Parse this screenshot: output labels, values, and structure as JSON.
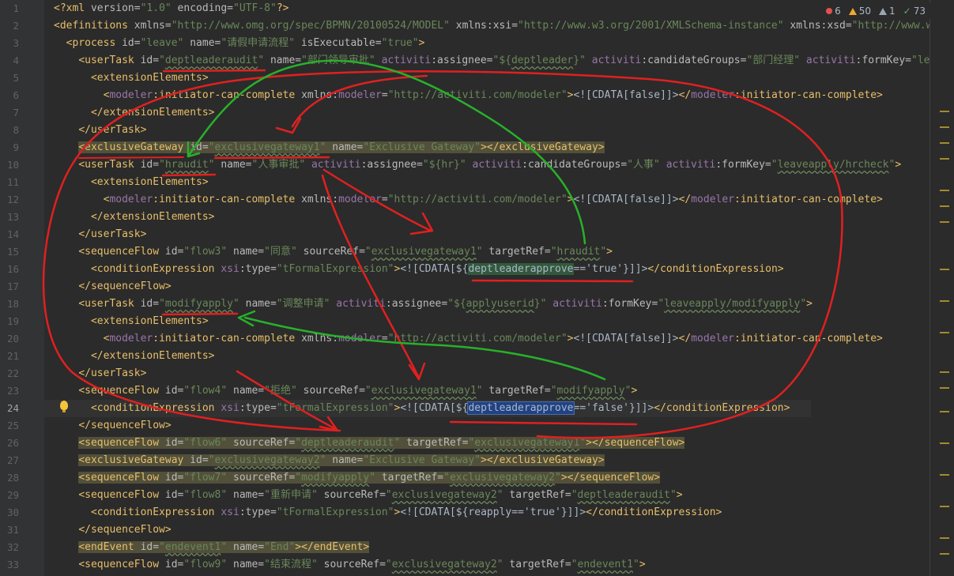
{
  "inspections": {
    "errors": "6",
    "warnings": "50",
    "weak": "1",
    "ok": "73"
  },
  "colors": {
    "annotation_red": "#e02020",
    "annotation_green": "#27b12a"
  },
  "current_line": "24",
  "lines": [
    {
      "n": "1",
      "tokens": [
        [
          "p",
          "<?"
        ],
        [
          "t",
          "xml "
        ],
        [
          "a",
          "version="
        ],
        [
          "v",
          "\"1.0\""
        ],
        [
          "a",
          " encoding="
        ],
        [
          "v",
          "\"UTF-8\""
        ],
        [
          "p",
          "?>"
        ]
      ]
    },
    {
      "n": "2",
      "tokens": [
        [
          "t",
          "<definitions "
        ],
        [
          "a",
          "xmlns="
        ],
        [
          "v",
          "\"http://www.omg.org/spec/BPMN/20100524/MODEL\""
        ],
        [
          "a",
          " xmlns:xsi="
        ],
        [
          "v",
          "\"http://www.w3.org/2001/XMLSchema-instance\""
        ],
        [
          "a",
          " xmlns:xsd="
        ],
        [
          "v",
          "\"http://www.w"
        ]
      ]
    },
    {
      "n": "3",
      "tokens": [
        [
          "x",
          "  "
        ],
        [
          "t",
          "<process "
        ],
        [
          "a",
          "id="
        ],
        [
          "v",
          "\"leave\""
        ],
        [
          "a",
          " name="
        ],
        [
          "v",
          "\"请假申请流程\""
        ],
        [
          "a",
          " isExecutable="
        ],
        [
          "v",
          "\"true\""
        ],
        [
          "t",
          ">"
        ]
      ]
    },
    {
      "n": "4",
      "tokens": [
        [
          "x",
          "    "
        ],
        [
          "t",
          "<userTask "
        ],
        [
          "a",
          "id="
        ],
        [
          "v",
          "\""
        ],
        [
          "vu",
          "deptleaderaudit"
        ],
        [
          "v",
          "\""
        ],
        [
          "a",
          " name="
        ],
        [
          "v",
          "\"部门领导审批\""
        ],
        [
          "a",
          " "
        ],
        [
          "n",
          "activiti"
        ],
        [
          "a",
          ":assignee="
        ],
        [
          "v",
          "\"${"
        ],
        [
          "vu",
          "deptleader"
        ],
        [
          "v",
          "}\""
        ],
        [
          "a",
          " "
        ],
        [
          "n",
          "activiti"
        ],
        [
          "a",
          ":candidateGroups="
        ],
        [
          "v",
          "\"部门经理\""
        ],
        [
          "a",
          " "
        ],
        [
          "n",
          "activiti"
        ],
        [
          "a",
          ":formKey="
        ],
        [
          "v",
          "\"lea"
        ]
      ]
    },
    {
      "n": "5",
      "tokens": [
        [
          "x",
          "      "
        ],
        [
          "t",
          "<extensionElements>"
        ]
      ]
    },
    {
      "n": "6",
      "tokens": [
        [
          "x",
          "        "
        ],
        [
          "t",
          "<"
        ],
        [
          "n",
          "modeler"
        ],
        [
          "t",
          ":initiator-can-complete "
        ],
        [
          "a",
          "xmlns:"
        ],
        [
          "n",
          "modeler"
        ],
        [
          "a",
          "="
        ],
        [
          "v",
          "\"http://activiti.com/modeler\""
        ],
        [
          "t",
          ">"
        ],
        [
          "x",
          "<![CDATA[false]]>"
        ],
        [
          "t",
          "</"
        ],
        [
          "n",
          "modeler"
        ],
        [
          "t",
          ":initiator-can-complete>"
        ]
      ]
    },
    {
      "n": "7",
      "tokens": [
        [
          "x",
          "      "
        ],
        [
          "t",
          "</extensionElements>"
        ]
      ]
    },
    {
      "n": "8",
      "tokens": [
        [
          "x",
          "    "
        ],
        [
          "t",
          "</userTask>"
        ]
      ]
    },
    {
      "n": "9",
      "hl": true,
      "tokens": [
        [
          "x",
          "    "
        ],
        [
          "t",
          "<exclusiveGateway "
        ],
        [
          "a",
          "id="
        ],
        [
          "v",
          "\""
        ],
        [
          "vu",
          "exclusivegateway1"
        ],
        [
          "v",
          "\""
        ],
        [
          "a",
          " name="
        ],
        [
          "v",
          "\"Exclusive Gateway\""
        ],
        [
          "t",
          "></exclusiveGateway>"
        ]
      ]
    },
    {
      "n": "10",
      "tokens": [
        [
          "x",
          "    "
        ],
        [
          "t",
          "<userTask "
        ],
        [
          "a",
          "id="
        ],
        [
          "v",
          "\""
        ],
        [
          "vu",
          "hraudit"
        ],
        [
          "v",
          "\""
        ],
        [
          "a",
          " name="
        ],
        [
          "v",
          "\"人事审批\""
        ],
        [
          "a",
          " "
        ],
        [
          "n",
          "activiti"
        ],
        [
          "a",
          ":assignee="
        ],
        [
          "v",
          "\"${hr}\""
        ],
        [
          "a",
          " "
        ],
        [
          "n",
          "activiti"
        ],
        [
          "a",
          ":candidateGroups="
        ],
        [
          "v",
          "\"人事\""
        ],
        [
          "a",
          " "
        ],
        [
          "n",
          "activiti"
        ],
        [
          "a",
          ":formKey="
        ],
        [
          "v",
          "\""
        ],
        [
          "vu",
          "leaveapply/hrcheck"
        ],
        [
          "v",
          "\""
        ],
        [
          "t",
          ">"
        ]
      ]
    },
    {
      "n": "11",
      "tokens": [
        [
          "x",
          "      "
        ],
        [
          "t",
          "<extensionElements>"
        ]
      ]
    },
    {
      "n": "12",
      "tokens": [
        [
          "x",
          "        "
        ],
        [
          "t",
          "<"
        ],
        [
          "n",
          "modeler"
        ],
        [
          "t",
          ":initiator-can-complete "
        ],
        [
          "a",
          "xmlns:"
        ],
        [
          "n",
          "modeler"
        ],
        [
          "a",
          "="
        ],
        [
          "v",
          "\"http://activiti.com/modeler\""
        ],
        [
          "t",
          ">"
        ],
        [
          "x",
          "<![CDATA[false]]>"
        ],
        [
          "t",
          "</"
        ],
        [
          "n",
          "modeler"
        ],
        [
          "t",
          ":initiator-can-complete>"
        ]
      ]
    },
    {
      "n": "13",
      "tokens": [
        [
          "x",
          "      "
        ],
        [
          "t",
          "</extensionElements>"
        ]
      ]
    },
    {
      "n": "14",
      "tokens": [
        [
          "x",
          "    "
        ],
        [
          "t",
          "</userTask>"
        ]
      ]
    },
    {
      "n": "15",
      "tokens": [
        [
          "x",
          "    "
        ],
        [
          "t",
          "<sequenceFlow "
        ],
        [
          "a",
          "id="
        ],
        [
          "v",
          "\"flow3\""
        ],
        [
          "a",
          " name="
        ],
        [
          "v",
          "\"同意\""
        ],
        [
          "a",
          " sourceRef="
        ],
        [
          "v",
          "\""
        ],
        [
          "vu",
          "exclusivegateway1"
        ],
        [
          "v",
          "\""
        ],
        [
          "a",
          " targetRef="
        ],
        [
          "v",
          "\""
        ],
        [
          "vu",
          "hraudit"
        ],
        [
          "v",
          "\""
        ],
        [
          "t",
          ">"
        ]
      ]
    },
    {
      "n": "16",
      "tokens": [
        [
          "x",
          "      "
        ],
        [
          "t",
          "<conditionExpression "
        ],
        [
          "n",
          "xsi"
        ],
        [
          "a",
          ":type="
        ],
        [
          "v",
          "\"tFormalExpression\""
        ],
        [
          "t",
          ">"
        ],
        [
          "x",
          "<![CDATA[${"
        ],
        [
          "s2",
          "deptleaderapprove"
        ],
        [
          "x",
          "=='true'}]]>"
        ],
        [
          "t",
          "</conditionExpression>"
        ]
      ]
    },
    {
      "n": "17",
      "tokens": [
        [
          "x",
          "    "
        ],
        [
          "t",
          "</sequenceFlow>"
        ]
      ]
    },
    {
      "n": "18",
      "tokens": [
        [
          "x",
          "    "
        ],
        [
          "t",
          "<userTask "
        ],
        [
          "a",
          "id="
        ],
        [
          "v",
          "\""
        ],
        [
          "vu",
          "modifyapply"
        ],
        [
          "v",
          "\""
        ],
        [
          "a",
          " name="
        ],
        [
          "v",
          "\"调整申请\""
        ],
        [
          "a",
          " "
        ],
        [
          "n",
          "activiti"
        ],
        [
          "a",
          ":assignee="
        ],
        [
          "v",
          "\"${"
        ],
        [
          "vu",
          "applyuserid"
        ],
        [
          "v",
          "}\""
        ],
        [
          "a",
          " "
        ],
        [
          "n",
          "activiti"
        ],
        [
          "a",
          ":formKey="
        ],
        [
          "v",
          "\""
        ],
        [
          "vu",
          "leaveapply/modifyapply"
        ],
        [
          "v",
          "\""
        ],
        [
          "t",
          ">"
        ]
      ]
    },
    {
      "n": "19",
      "tokens": [
        [
          "x",
          "      "
        ],
        [
          "t",
          "<extensionElements>"
        ]
      ]
    },
    {
      "n": "20",
      "tokens": [
        [
          "x",
          "        "
        ],
        [
          "t",
          "<"
        ],
        [
          "n",
          "modeler"
        ],
        [
          "t",
          ":initiator-can-complete "
        ],
        [
          "a",
          "xmlns:"
        ],
        [
          "n",
          "modeler"
        ],
        [
          "a",
          "="
        ],
        [
          "v",
          "\"http://activiti.com/modeler\""
        ],
        [
          "t",
          ">"
        ],
        [
          "x",
          "<![CDATA[false]]>"
        ],
        [
          "t",
          "</"
        ],
        [
          "n",
          "modeler"
        ],
        [
          "t",
          ":initiator-can-complete>"
        ]
      ]
    },
    {
      "n": "21",
      "tokens": [
        [
          "x",
          "      "
        ],
        [
          "t",
          "</extensionElements>"
        ]
      ]
    },
    {
      "n": "22",
      "tokens": [
        [
          "x",
          "    "
        ],
        [
          "t",
          "</userTask>"
        ]
      ]
    },
    {
      "n": "23",
      "tokens": [
        [
          "x",
          "    "
        ],
        [
          "t",
          "<sequenceFlow "
        ],
        [
          "a",
          "id="
        ],
        [
          "v",
          "\"flow4\""
        ],
        [
          "a",
          " name="
        ],
        [
          "v",
          "\"拒绝\""
        ],
        [
          "a",
          " sourceRef="
        ],
        [
          "v",
          "\""
        ],
        [
          "vu",
          "exclusivegateway1"
        ],
        [
          "v",
          "\""
        ],
        [
          "a",
          " targetRef="
        ],
        [
          "v",
          "\""
        ],
        [
          "vu",
          "modifyapply"
        ],
        [
          "v",
          "\""
        ],
        [
          "t",
          ">"
        ]
      ]
    },
    {
      "n": "24",
      "cur": true,
      "tokens": [
        [
          "x",
          "      "
        ],
        [
          "t",
          "<conditionExpression "
        ],
        [
          "n",
          "xsi"
        ],
        [
          "a",
          ":type="
        ],
        [
          "v",
          "\"tFormalExpression\""
        ],
        [
          "t",
          ">"
        ],
        [
          "x",
          "<![CDATA[${"
        ],
        [
          "s1",
          "deptleaderapprove"
        ],
        [
          "x",
          "=='false'}]]>"
        ],
        [
          "t",
          "</conditionExpression>"
        ]
      ]
    },
    {
      "n": "25",
      "tokens": [
        [
          "x",
          "    "
        ],
        [
          "t",
          "</sequenceFlow>"
        ]
      ]
    },
    {
      "n": "26",
      "hl": true,
      "tokens": [
        [
          "x",
          "    "
        ],
        [
          "t",
          "<sequenceFlow "
        ],
        [
          "a",
          "id="
        ],
        [
          "v",
          "\"flow6\""
        ],
        [
          "a",
          " sourceRef="
        ],
        [
          "v",
          "\""
        ],
        [
          "vu",
          "deptleaderaudit"
        ],
        [
          "v",
          "\""
        ],
        [
          "a",
          " targetRef="
        ],
        [
          "v",
          "\""
        ],
        [
          "vu",
          "exclusivegateway1"
        ],
        [
          "v",
          "\""
        ],
        [
          "t",
          "></sequenceFlow>"
        ]
      ]
    },
    {
      "n": "27",
      "hl": true,
      "tokens": [
        [
          "x",
          "    "
        ],
        [
          "t",
          "<exclusiveGateway "
        ],
        [
          "a",
          "id="
        ],
        [
          "v",
          "\""
        ],
        [
          "vu",
          "exclusivegateway2"
        ],
        [
          "v",
          "\""
        ],
        [
          "a",
          " name="
        ],
        [
          "v",
          "\"Exclusive Gateway\""
        ],
        [
          "t",
          "></exclusiveGateway>"
        ]
      ]
    },
    {
      "n": "28",
      "hl": true,
      "tokens": [
        [
          "x",
          "    "
        ],
        [
          "t",
          "<sequenceFlow "
        ],
        [
          "a",
          "id="
        ],
        [
          "v",
          "\"flow7\""
        ],
        [
          "a",
          " sourceRef="
        ],
        [
          "v",
          "\""
        ],
        [
          "vu",
          "modifyapply"
        ],
        [
          "v",
          "\""
        ],
        [
          "a",
          " targetRef="
        ],
        [
          "v",
          "\""
        ],
        [
          "vu",
          "exclusivegateway2"
        ],
        [
          "v",
          "\""
        ],
        [
          "t",
          "></sequenceFlow>"
        ]
      ]
    },
    {
      "n": "29",
      "tokens": [
        [
          "x",
          "    "
        ],
        [
          "t",
          "<sequenceFlow "
        ],
        [
          "a",
          "id="
        ],
        [
          "v",
          "\"flow8\""
        ],
        [
          "a",
          " name="
        ],
        [
          "v",
          "\"重新申请\""
        ],
        [
          "a",
          " sourceRef="
        ],
        [
          "v",
          "\""
        ],
        [
          "vu",
          "exclusivegateway2"
        ],
        [
          "v",
          "\""
        ],
        [
          "a",
          " targetRef="
        ],
        [
          "v",
          "\""
        ],
        [
          "vu",
          "deptleaderaudit"
        ],
        [
          "v",
          "\""
        ],
        [
          "t",
          ">"
        ]
      ]
    },
    {
      "n": "30",
      "tokens": [
        [
          "x",
          "      "
        ],
        [
          "t",
          "<conditionExpression "
        ],
        [
          "n",
          "xsi"
        ],
        [
          "a",
          ":type="
        ],
        [
          "v",
          "\"tFormalExpression\""
        ],
        [
          "t",
          ">"
        ],
        [
          "x",
          "<![CDATA[${reapply=='true'}]]>"
        ],
        [
          "t",
          "</conditionExpression>"
        ]
      ]
    },
    {
      "n": "31",
      "tokens": [
        [
          "x",
          "    "
        ],
        [
          "t",
          "</sequenceFlow>"
        ]
      ]
    },
    {
      "n": "32",
      "hl": true,
      "tokens": [
        [
          "x",
          "    "
        ],
        [
          "t",
          "<endEvent "
        ],
        [
          "a",
          "id="
        ],
        [
          "v",
          "\""
        ],
        [
          "vu",
          "endevent1"
        ],
        [
          "v",
          "\""
        ],
        [
          "a",
          " name="
        ],
        [
          "v",
          "\"End\""
        ],
        [
          "t",
          "></endEvent>"
        ]
      ]
    },
    {
      "n": "33",
      "tokens": [
        [
          "x",
          "    "
        ],
        [
          "t",
          "<sequenceFlow "
        ],
        [
          "a",
          "id="
        ],
        [
          "v",
          "\"flow9\""
        ],
        [
          "a",
          " name="
        ],
        [
          "v",
          "\"结束流程\""
        ],
        [
          "a",
          " sourceRef="
        ],
        [
          "v",
          "\""
        ],
        [
          "vu",
          "exclusivegateway2"
        ],
        [
          "v",
          "\""
        ],
        [
          "a",
          " targetRef="
        ],
        [
          "v",
          "\""
        ],
        [
          "vu",
          "endevent1"
        ],
        [
          "v",
          "\""
        ],
        [
          "t",
          ">"
        ]
      ]
    }
  ]
}
